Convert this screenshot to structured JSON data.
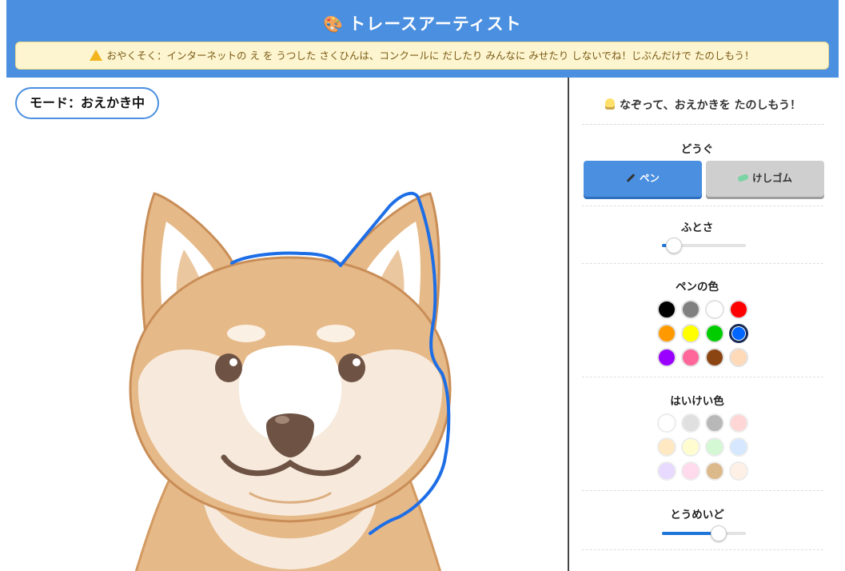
{
  "header": {
    "title": "トレースアーティスト",
    "notice": "おやくそく：インターネットの え を うつした さくひんは、コンクールに だしたり みんなに みせたり しないでね！じぶんだけで たのしもう！"
  },
  "canvas": {
    "mode_label": "モード：おえかき中"
  },
  "panel": {
    "tip": "なぞって、おえかきを たのしもう！",
    "tools": {
      "label": "どうぐ",
      "pen_label": "ペン",
      "eraser_label": "けしゴム",
      "active": "pen"
    },
    "thickness": {
      "label": "ふとさ",
      "value_fraction": 0.14
    },
    "pen_colors": {
      "label": "ペンの色",
      "colors": [
        "#000000",
        "#808080",
        "#ffffff",
        "#ff0000",
        "#ff9900",
        "#ffff00",
        "#00cc00",
        "#0066ff",
        "#9900ff",
        "#ff6699",
        "#8b4513",
        "#ffdab9"
      ],
      "selected": "#0066ff"
    },
    "background_colors": {
      "label": "はいけい色",
      "colors": [
        "#ffffff",
        "#e0e0e0",
        "#b8b8b8",
        "#ffd6d6",
        "#ffe8c2",
        "#fffdd0",
        "#d4f7d4",
        "#d6e8ff",
        "#e8d9ff",
        "#ffdaec",
        "#dcb98a",
        "#fff0e6"
      ]
    },
    "opacity": {
      "label": "とうめいど",
      "value_fraction": 0.68
    }
  },
  "colors": {
    "accent": "#4a8fe0",
    "stroke": "#1e6ee6"
  }
}
